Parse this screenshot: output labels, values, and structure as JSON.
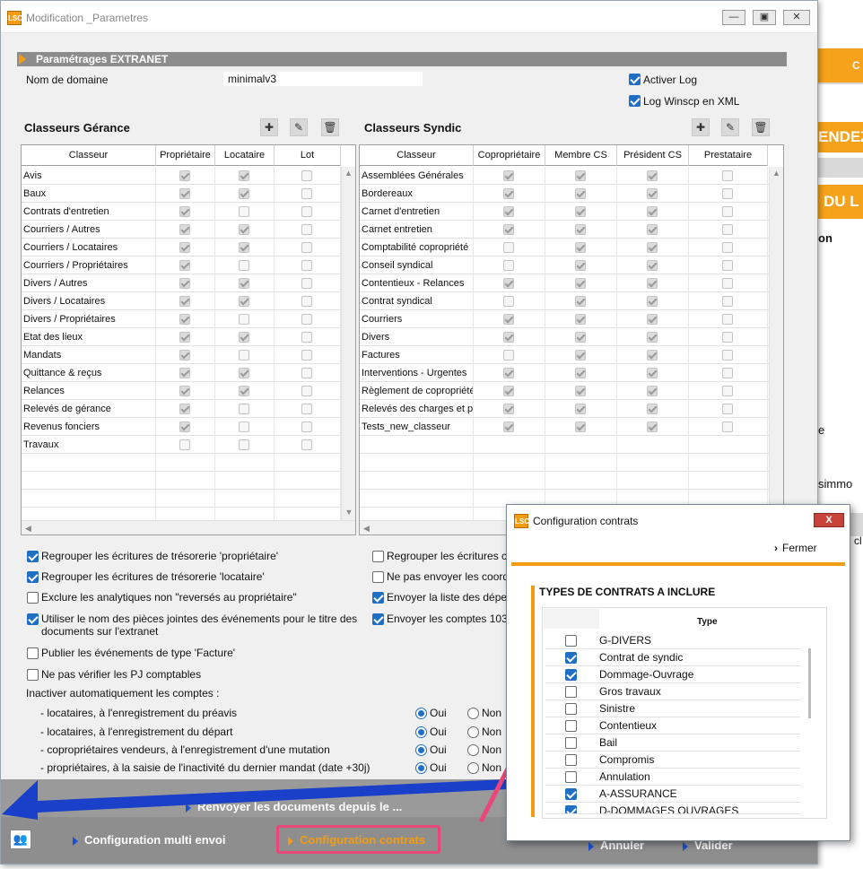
{
  "background_app": {
    "orange_button1": "C",
    "orange_banner": "ENDEZ",
    "orange_banner2": "DU L",
    "text1": "on",
    "text2": "e",
    "text3": "simmo",
    "text4": "cl"
  },
  "window": {
    "title": "Modification _Parametres",
    "icon": "LSC"
  },
  "section_title": "Paramétrages EXTRANET",
  "domain": {
    "label": "Nom de domaine",
    "value": "minimalv3"
  },
  "options_top": {
    "activer_log": {
      "label": "Activer Log",
      "checked": true
    },
    "log_xml": {
      "label": "Log Winscp en XML",
      "checked": true
    }
  },
  "gerance": {
    "title": "Classeurs Gérance",
    "columns": [
      "Classeur",
      "Propriétaire",
      "Locataire",
      "Lot"
    ],
    "rows": [
      {
        "name": "Avis",
        "c": [
          true,
          true,
          false
        ]
      },
      {
        "name": "Baux",
        "c": [
          true,
          true,
          false
        ]
      },
      {
        "name": "Contrats d'entretien",
        "c": [
          true,
          false,
          false
        ]
      },
      {
        "name": "Courriers / Autres",
        "c": [
          true,
          true,
          false
        ]
      },
      {
        "name": "Courriers / Locataires",
        "c": [
          true,
          true,
          false
        ]
      },
      {
        "name": "Courriers / Propriétaires",
        "c": [
          true,
          false,
          false
        ]
      },
      {
        "name": "Divers / Autres",
        "c": [
          true,
          true,
          false
        ]
      },
      {
        "name": "Divers / Locataires",
        "c": [
          true,
          true,
          false
        ]
      },
      {
        "name": "Divers / Propriétaires",
        "c": [
          true,
          false,
          false
        ]
      },
      {
        "name": "Etat des lieux",
        "c": [
          true,
          true,
          false
        ]
      },
      {
        "name": "Mandats",
        "c": [
          true,
          false,
          false
        ]
      },
      {
        "name": "Quittance & reçus",
        "c": [
          true,
          true,
          false
        ]
      },
      {
        "name": "Relances",
        "c": [
          true,
          true,
          false
        ]
      },
      {
        "name": "Relevés de gérance",
        "c": [
          true,
          false,
          false
        ]
      },
      {
        "name": "Revenus fonciers",
        "c": [
          true,
          false,
          false
        ]
      },
      {
        "name": "Travaux",
        "c": [
          false,
          false,
          false
        ]
      }
    ]
  },
  "syndic": {
    "title": "Classeurs Syndic",
    "columns": [
      "Classeur",
      "Copropriétaire",
      "Membre CS",
      "Président CS",
      "Prestataire"
    ],
    "rows": [
      {
        "name": "Assemblées Générales",
        "c": [
          true,
          true,
          true,
          false
        ]
      },
      {
        "name": "Bordereaux",
        "c": [
          true,
          true,
          true,
          false
        ]
      },
      {
        "name": "Carnet d'entretien",
        "c": [
          true,
          true,
          true,
          false
        ]
      },
      {
        "name": "Carnet entretien",
        "c": [
          true,
          true,
          true,
          false
        ]
      },
      {
        "name": "Comptabilité copropriété",
        "c": [
          false,
          true,
          true,
          false
        ]
      },
      {
        "name": "Conseil syndical",
        "c": [
          false,
          true,
          true,
          false
        ]
      },
      {
        "name": "Contentieux - Relances",
        "c": [
          true,
          true,
          true,
          false
        ]
      },
      {
        "name": "Contrat syndical",
        "c": [
          false,
          true,
          true,
          false
        ]
      },
      {
        "name": "Courriers",
        "c": [
          true,
          true,
          true,
          false
        ]
      },
      {
        "name": "Divers",
        "c": [
          true,
          true,
          true,
          false
        ]
      },
      {
        "name": "Factures",
        "c": [
          false,
          true,
          true,
          false
        ]
      },
      {
        "name": "Interventions - Urgentes",
        "c": [
          true,
          true,
          true,
          false
        ]
      },
      {
        "name": "Règlement de copropriété",
        "c": [
          true,
          true,
          true,
          false
        ]
      },
      {
        "name": "Relevés des charges et pr",
        "c": [
          true,
          true,
          true,
          false
        ]
      },
      {
        "name": "Tests_new_classeur",
        "c": [
          true,
          true,
          true,
          false
        ]
      }
    ]
  },
  "options_left": [
    {
      "label": "Regrouper les écritures de trésorerie 'propriétaire'",
      "checked": true
    },
    {
      "label": "Regrouper les écritures de trésorerie 'locataire'",
      "checked": true
    },
    {
      "label": "Exclure les analytiques non \"reversés au propriétaire\"",
      "checked": false
    },
    {
      "label": "Utiliser le nom des pièces jointes des événements pour le titre des",
      "label2": "documents sur l'extranet",
      "checked": true
    },
    {
      "label": "Publier les événements de type 'Facture'",
      "checked": false
    },
    {
      "label": "Ne pas vérifier les PJ comptables",
      "checked": false
    }
  ],
  "options_right": [
    {
      "label": "Regrouper les écritures c",
      "checked": false
    },
    {
      "label": "Ne pas envoyer les coord",
      "checked": false
    },
    {
      "label": "Envoyer la liste des dépe",
      "checked": true
    },
    {
      "label": "Envoyer les comptes 103",
      "checked": true
    }
  ],
  "inactivate": {
    "label": "Inactiver automatiquement les comptes :",
    "oui": "Oui",
    "non": "Non",
    "rows": [
      {
        "label": "- locataires, à l'enregistrement du préavis",
        "value": "Oui"
      },
      {
        "label": "- locataires, à l'enregistrement du départ",
        "value": "Oui"
      },
      {
        "label": "- copropriétaires vendeurs, à l'enregistrement d'une mutation",
        "value": "Oui"
      },
      {
        "label": "- propriétaires, à la saisie de l'inactivité du dernier mandat (date +30j)",
        "value": "Oui"
      }
    ]
  },
  "bottom": {
    "renvoyer": "Renvoyer les documents depuis le ...",
    "multi_envoi": "Configuration multi envoi",
    "contrats": "Configuration contrats",
    "annuler": "Annuler",
    "valider": "Valider"
  },
  "dialog": {
    "title": "Configuration contrats",
    "icon": "LSC",
    "close": "X",
    "fermer": "Fermer",
    "section": "TYPES DE CONTRATS A INCLURE",
    "column": "Type",
    "rows": [
      {
        "name": "G-DIVERS",
        "checked": false
      },
      {
        "name": "Contrat de syndic",
        "checked": true
      },
      {
        "name": "Dommage-Ouvrage",
        "checked": true
      },
      {
        "name": "Gros travaux",
        "checked": false
      },
      {
        "name": "Sinistre",
        "checked": false
      },
      {
        "name": "Contentieux",
        "checked": false
      },
      {
        "name": "Bail",
        "checked": false
      },
      {
        "name": "Compromis",
        "checked": false
      },
      {
        "name": "Annulation",
        "checked": false
      },
      {
        "name": "A-ASSURANCE",
        "checked": true
      },
      {
        "name": "D-DOMMAGES OUVRAGES",
        "checked": true
      }
    ]
  },
  "colors": {
    "accent_orange": "#f39c12",
    "check_blue": "#1f6fc5",
    "annotation_pink": "#e9467a",
    "annotation_blue": "#1a3fc9"
  }
}
